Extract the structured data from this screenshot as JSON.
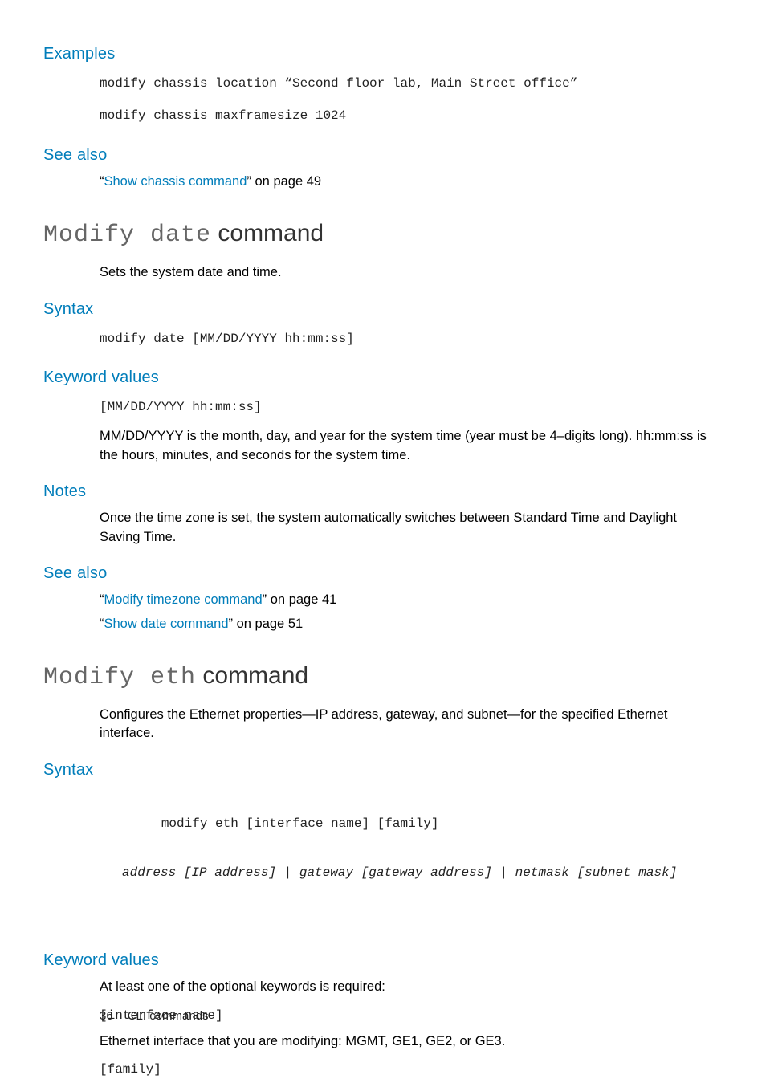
{
  "sec_examples": {
    "heading": "Examples",
    "code1": "modify chassis location “Second floor lab, Main Street office”",
    "code2": "modify chassis maxframesize 1024"
  },
  "sec_seealso1": {
    "heading": "See also",
    "quote_open": "“",
    "link": "Show chassis command",
    "tail": "” on page 49"
  },
  "cmd_date": {
    "title_mono": "Modify date",
    "title_rest": " command",
    "desc": "Sets the system date and time.",
    "syntax_h": "Syntax",
    "syntax_code": "modify date [MM/DD/YYYY hh:mm:ss]",
    "kv_h": "Keyword values",
    "kv_code": "[MM/DD/YYYY hh:mm:ss]",
    "kv_para": "MM/DD/YYYY is the month, day, and year for the system time (year must be 4–digits long). hh:mm:ss is the hours, minutes, and seconds for the system time.",
    "notes_h": "Notes",
    "notes_para": "Once the time zone is set, the system automatically switches between Standard Time and Daylight Saving Time.",
    "seealso_h": "See also",
    "sa_q1": "“",
    "sa_link1": "Modify timezone command",
    "sa_t1": "” on page 41",
    "sa_q2": "“",
    "sa_link2": "Show date command",
    "sa_t2": "” on page 51"
  },
  "cmd_eth": {
    "title_mono": "Modify eth",
    "title_rest": " command",
    "desc": "Configures the Ethernet properties—IP address, gateway, and subnet—for the specified Ethernet interface.",
    "syntax_h": "Syntax",
    "syntax_line1": "modify eth [interface name] [family]",
    "syntax_line2": "address [IP address] | gateway [gateway address] | netmask [subnet mask]",
    "kv_h": "Keyword values",
    "kv_intro": "At least one of the optional keywords is required:",
    "kv_code1": "[interface name]",
    "kv_para1": "Ethernet interface that you are modifying: MGMT, GE1, GE2, or GE3.",
    "kv_code2": "[family]"
  },
  "footer": {
    "page": "36",
    "title": "CLI commands"
  }
}
